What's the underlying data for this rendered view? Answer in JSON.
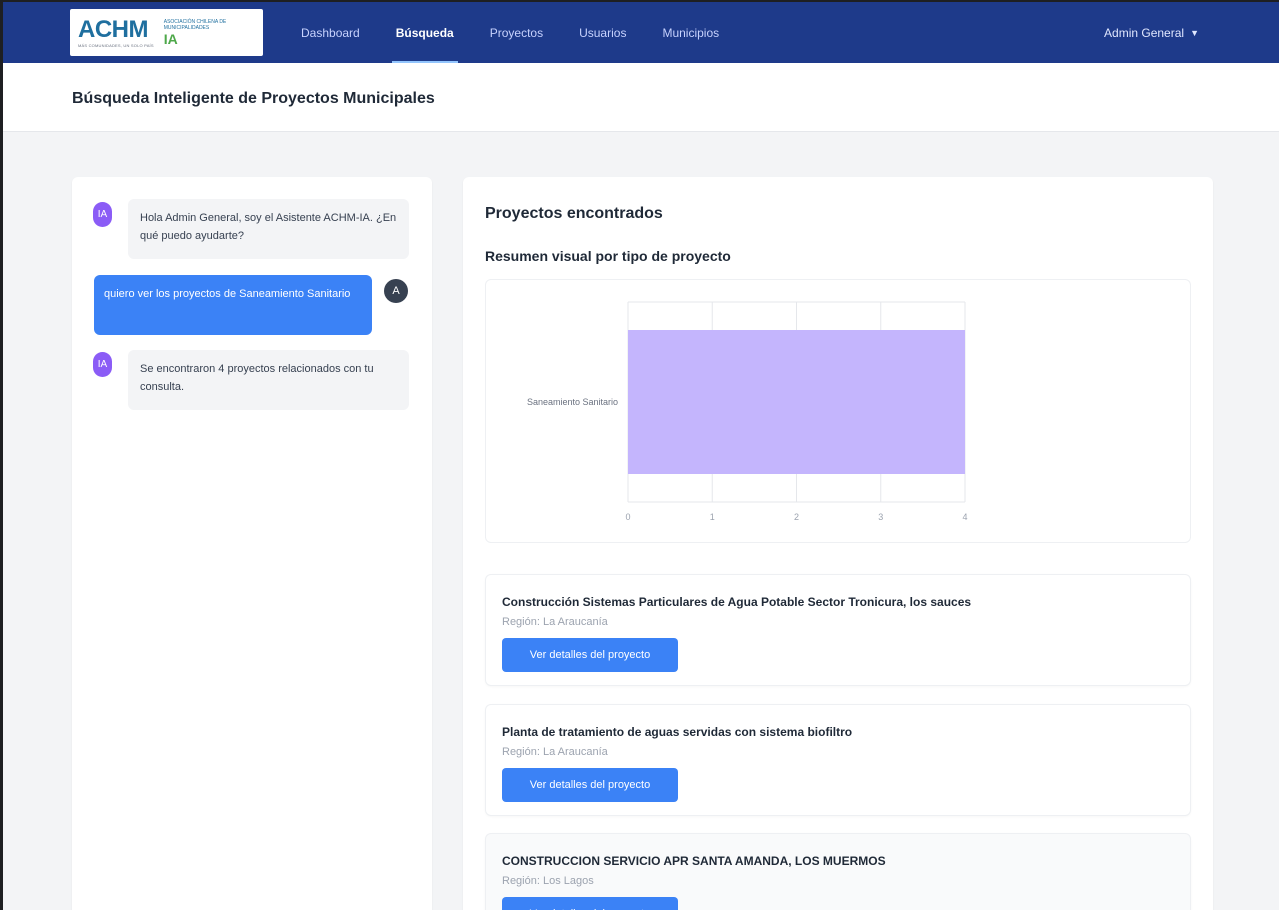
{
  "navbar": {
    "logo_text": "ACHM",
    "logo_tagline": "MÁS COMUNIDADES, UN SOLO PAÍS",
    "logo_association": "ASOCIACIÓN CHILENA DE MUNICIPALIDADES",
    "logo_ia": "IA",
    "links": [
      {
        "label": "Dashboard",
        "active": false
      },
      {
        "label": "Búsqueda",
        "active": true
      },
      {
        "label": "Proyectos",
        "active": false
      },
      {
        "label": "Usuarios",
        "active": false
      },
      {
        "label": "Municipios",
        "active": false
      }
    ],
    "user": "Admin General",
    "caret_icon": "chevron-down-icon"
  },
  "header": {
    "title": "Búsqueda Inteligente de Proyectos Municipales"
  },
  "chat": {
    "messages": [
      {
        "sender": "ai",
        "avatar": "IA",
        "text": "Hola Admin General, soy el Asistente ACHM-IA. ¿En qué puedo ayudarte?"
      },
      {
        "sender": "user",
        "avatar": "A",
        "text": "quiero ver los proyectos de Saneamiento Sanitario"
      },
      {
        "sender": "ai",
        "avatar": "IA",
        "text": "Se encontraron 4 proyectos relacionados con tu consulta."
      }
    ]
  },
  "results": {
    "title": "Proyectos encontrados",
    "chart_subtitle": "Resumen visual por tipo de proyecto",
    "projects": [
      {
        "name": "Construcción Sistemas Particulares de Agua Potable Sector Tronicura, los sauces",
        "region": "Región: La Araucanía",
        "button": "Ver detalles del proyecto"
      },
      {
        "name": "Planta de tratamiento de aguas servidas con sistema biofiltro",
        "region": "Región: La Araucanía",
        "button": "Ver detalles del proyecto"
      },
      {
        "name": "CONSTRUCCION SERVICIO APR SANTA AMANDA, LOS MUERMOS",
        "region": "Región: Los Lagos",
        "button": "Ver detalles del proyecto"
      }
    ]
  },
  "chart_data": {
    "type": "bar",
    "orientation": "horizontal",
    "categories": [
      "Saneamiento Sanitario"
    ],
    "values": [
      4
    ],
    "xlim": [
      0,
      4
    ],
    "xticks": [
      "0",
      "1",
      "2",
      "3",
      "4"
    ],
    "grid": true,
    "bar_color": "#c4b5fd"
  }
}
